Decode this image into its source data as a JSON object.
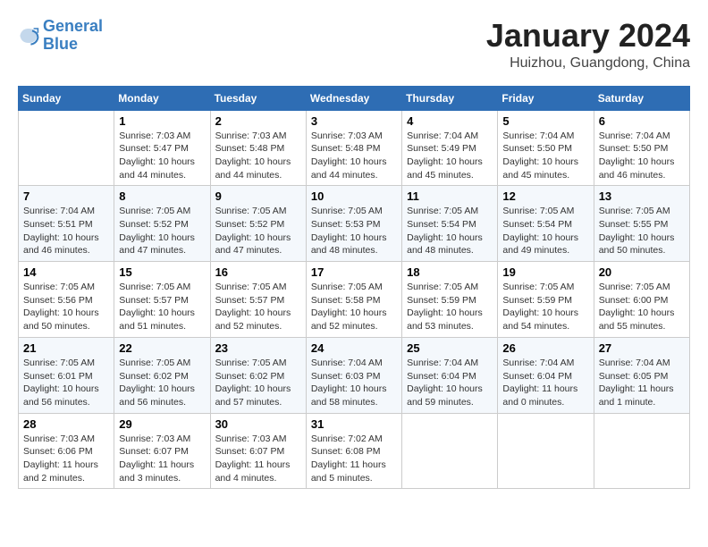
{
  "header": {
    "logo_line1": "General",
    "logo_line2": "Blue",
    "month": "January 2024",
    "location": "Huizhou, Guangdong, China"
  },
  "weekdays": [
    "Sunday",
    "Monday",
    "Tuesday",
    "Wednesday",
    "Thursday",
    "Friday",
    "Saturday"
  ],
  "weeks": [
    [
      {
        "day": "",
        "info": ""
      },
      {
        "day": "1",
        "info": "Sunrise: 7:03 AM\nSunset: 5:47 PM\nDaylight: 10 hours\nand 44 minutes."
      },
      {
        "day": "2",
        "info": "Sunrise: 7:03 AM\nSunset: 5:48 PM\nDaylight: 10 hours\nand 44 minutes."
      },
      {
        "day": "3",
        "info": "Sunrise: 7:03 AM\nSunset: 5:48 PM\nDaylight: 10 hours\nand 44 minutes."
      },
      {
        "day": "4",
        "info": "Sunrise: 7:04 AM\nSunset: 5:49 PM\nDaylight: 10 hours\nand 45 minutes."
      },
      {
        "day": "5",
        "info": "Sunrise: 7:04 AM\nSunset: 5:50 PM\nDaylight: 10 hours\nand 45 minutes."
      },
      {
        "day": "6",
        "info": "Sunrise: 7:04 AM\nSunset: 5:50 PM\nDaylight: 10 hours\nand 46 minutes."
      }
    ],
    [
      {
        "day": "7",
        "info": "Sunrise: 7:04 AM\nSunset: 5:51 PM\nDaylight: 10 hours\nand 46 minutes."
      },
      {
        "day": "8",
        "info": "Sunrise: 7:05 AM\nSunset: 5:52 PM\nDaylight: 10 hours\nand 47 minutes."
      },
      {
        "day": "9",
        "info": "Sunrise: 7:05 AM\nSunset: 5:52 PM\nDaylight: 10 hours\nand 47 minutes."
      },
      {
        "day": "10",
        "info": "Sunrise: 7:05 AM\nSunset: 5:53 PM\nDaylight: 10 hours\nand 48 minutes."
      },
      {
        "day": "11",
        "info": "Sunrise: 7:05 AM\nSunset: 5:54 PM\nDaylight: 10 hours\nand 48 minutes."
      },
      {
        "day": "12",
        "info": "Sunrise: 7:05 AM\nSunset: 5:54 PM\nDaylight: 10 hours\nand 49 minutes."
      },
      {
        "day": "13",
        "info": "Sunrise: 7:05 AM\nSunset: 5:55 PM\nDaylight: 10 hours\nand 50 minutes."
      }
    ],
    [
      {
        "day": "14",
        "info": "Sunrise: 7:05 AM\nSunset: 5:56 PM\nDaylight: 10 hours\nand 50 minutes."
      },
      {
        "day": "15",
        "info": "Sunrise: 7:05 AM\nSunset: 5:57 PM\nDaylight: 10 hours\nand 51 minutes."
      },
      {
        "day": "16",
        "info": "Sunrise: 7:05 AM\nSunset: 5:57 PM\nDaylight: 10 hours\nand 52 minutes."
      },
      {
        "day": "17",
        "info": "Sunrise: 7:05 AM\nSunset: 5:58 PM\nDaylight: 10 hours\nand 52 minutes."
      },
      {
        "day": "18",
        "info": "Sunrise: 7:05 AM\nSunset: 5:59 PM\nDaylight: 10 hours\nand 53 minutes."
      },
      {
        "day": "19",
        "info": "Sunrise: 7:05 AM\nSunset: 5:59 PM\nDaylight: 10 hours\nand 54 minutes."
      },
      {
        "day": "20",
        "info": "Sunrise: 7:05 AM\nSunset: 6:00 PM\nDaylight: 10 hours\nand 55 minutes."
      }
    ],
    [
      {
        "day": "21",
        "info": "Sunrise: 7:05 AM\nSunset: 6:01 PM\nDaylight: 10 hours\nand 56 minutes."
      },
      {
        "day": "22",
        "info": "Sunrise: 7:05 AM\nSunset: 6:02 PM\nDaylight: 10 hours\nand 56 minutes."
      },
      {
        "day": "23",
        "info": "Sunrise: 7:05 AM\nSunset: 6:02 PM\nDaylight: 10 hours\nand 57 minutes."
      },
      {
        "day": "24",
        "info": "Sunrise: 7:04 AM\nSunset: 6:03 PM\nDaylight: 10 hours\nand 58 minutes."
      },
      {
        "day": "25",
        "info": "Sunrise: 7:04 AM\nSunset: 6:04 PM\nDaylight: 10 hours\nand 59 minutes."
      },
      {
        "day": "26",
        "info": "Sunrise: 7:04 AM\nSunset: 6:04 PM\nDaylight: 11 hours\nand 0 minutes."
      },
      {
        "day": "27",
        "info": "Sunrise: 7:04 AM\nSunset: 6:05 PM\nDaylight: 11 hours\nand 1 minute."
      }
    ],
    [
      {
        "day": "28",
        "info": "Sunrise: 7:03 AM\nSunset: 6:06 PM\nDaylight: 11 hours\nand 2 minutes."
      },
      {
        "day": "29",
        "info": "Sunrise: 7:03 AM\nSunset: 6:07 PM\nDaylight: 11 hours\nand 3 minutes."
      },
      {
        "day": "30",
        "info": "Sunrise: 7:03 AM\nSunset: 6:07 PM\nDaylight: 11 hours\nand 4 minutes."
      },
      {
        "day": "31",
        "info": "Sunrise: 7:02 AM\nSunset: 6:08 PM\nDaylight: 11 hours\nand 5 minutes."
      },
      {
        "day": "",
        "info": ""
      },
      {
        "day": "",
        "info": ""
      },
      {
        "day": "",
        "info": ""
      }
    ]
  ]
}
